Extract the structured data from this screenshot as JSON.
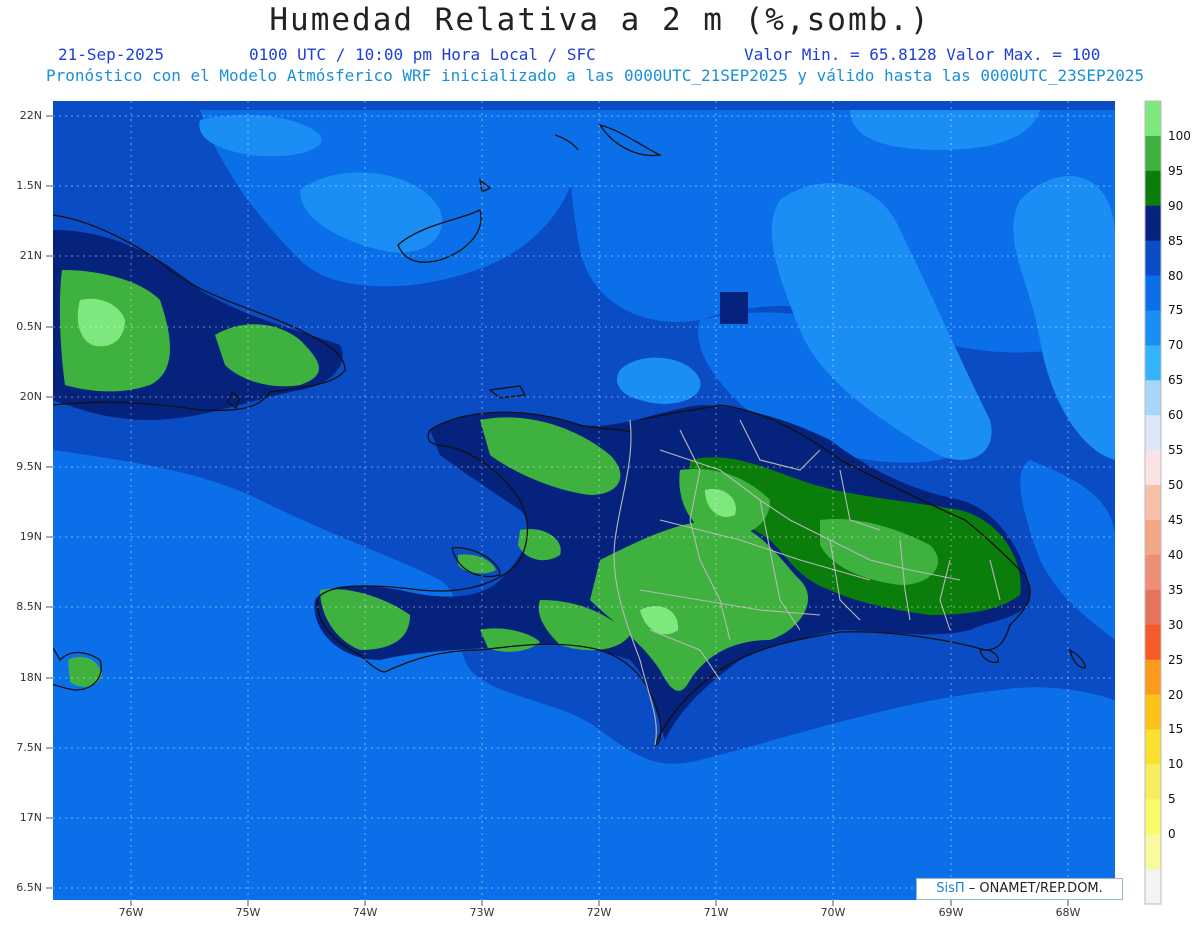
{
  "header": {
    "title": "Humedad Relativa a 2 m (%,somb.)",
    "date": "21-Sep-2025",
    "time": "0100 UTC / 10:00 pm Hora Local / SFC",
    "minmax": "Valor Min. = 65.8128  Valor Max. = 100",
    "forecast_line": "Pronóstico con el Modelo Atmósferico WRF inicializado a las 0000UTC_21SEP2025 y válido hasta las  0000UTC_23SEP2025"
  },
  "axes": {
    "y_labels": [
      "22N",
      "1.5N",
      "21N",
      "0.5N",
      "20N",
      "9.5N",
      "19N",
      "8.5N",
      "18N",
      "7.5N",
      "17N",
      "6.5N"
    ],
    "x_labels": [
      "76W",
      "75W",
      "74W",
      "73W",
      "72W",
      "71W",
      "70W",
      "69W",
      "68W"
    ]
  },
  "colorbar": {
    "labels": [
      "100",
      "95",
      "90",
      "85",
      "80",
      "75",
      "70",
      "65",
      "60",
      "55",
      "50",
      "45",
      "40",
      "35",
      "30",
      "25",
      "20",
      "15",
      "10",
      "5",
      "0"
    ],
    "colors": [
      "#7ee87e",
      "#3fb13f",
      "#0b7d0b",
      "#05237d",
      "#0a4cc4",
      "#0a6fe8",
      "#1a8ef5",
      "#33b4fa",
      "#a8d6fa",
      "#dde6fa",
      "#fbe3e3",
      "#f6c1a6",
      "#f2a786",
      "#ed8f76",
      "#e7735f",
      "#f65a2b",
      "#fc9a1e",
      "#fcc219",
      "#fae030",
      "#f5ee60",
      "#fafa6a",
      "#f9f99e",
      "#f4f4f4"
    ]
  },
  "credit": {
    "brand": "SisΠ",
    "text": " – ONAMET/REP.DOM."
  }
}
